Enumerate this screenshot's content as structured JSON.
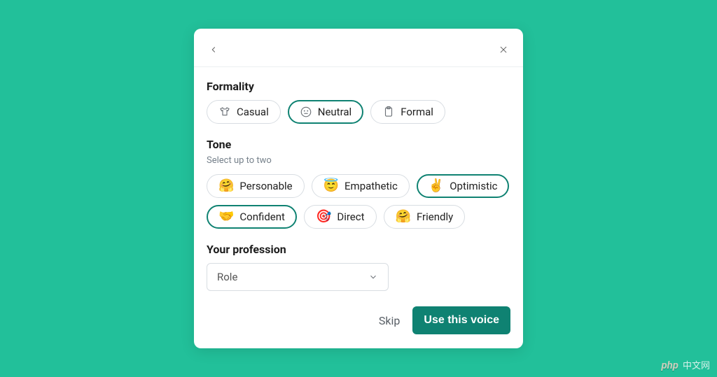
{
  "formality": {
    "title": "Formality",
    "options": [
      {
        "label": "Casual",
        "icon": "tshirt",
        "selected": false
      },
      {
        "label": "Neutral",
        "icon": "neutral",
        "selected": true
      },
      {
        "label": "Formal",
        "icon": "clipboard",
        "selected": false
      }
    ]
  },
  "tone": {
    "title": "Tone",
    "subtitle": "Select up to two",
    "options": [
      {
        "label": "Personable",
        "emoji": "🤗",
        "selected": false
      },
      {
        "label": "Empathetic",
        "emoji": "😇",
        "selected": false
      },
      {
        "label": "Optimistic",
        "emoji": "✌️",
        "selected": true
      },
      {
        "label": "Confident",
        "emoji": "🤝",
        "selected": true
      },
      {
        "label": "Direct",
        "emoji": "🎯",
        "selected": false
      },
      {
        "label": "Friendly",
        "emoji": "🤗",
        "selected": false
      }
    ]
  },
  "profession": {
    "title": "Your profession",
    "placeholder": "Role"
  },
  "footer": {
    "skip": "Skip",
    "primary": "Use this voice"
  },
  "watermark": {
    "badge": "php",
    "text": "中文网"
  }
}
